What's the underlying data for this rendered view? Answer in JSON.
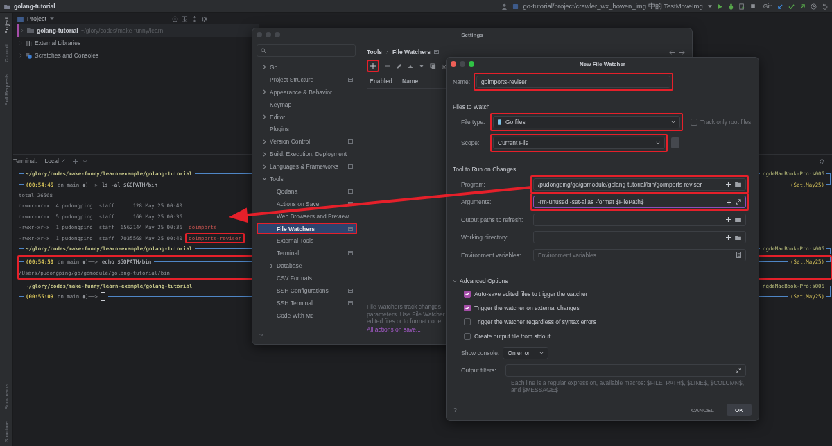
{
  "ide": {
    "project_name": "golang-tutorial",
    "run_config": "go-tutorial/project/crawler_wx_bowen_img 中的 TestMoveImg",
    "vcs_label": "Git:"
  },
  "tool_strip": {
    "top": [
      {
        "label": "Project",
        "selected": true
      },
      {
        "label": "Commit",
        "selected": false
      },
      {
        "label": "Pull Requests",
        "selected": false
      }
    ],
    "bottom": [
      {
        "label": "Bookmarks",
        "selected": false
      },
      {
        "label": "Structure",
        "selected": false
      }
    ]
  },
  "project_panel": {
    "title": "Project",
    "tree": [
      {
        "kind": "folder",
        "label": "golang-tutorial",
        "path": "~/glory/codes/make-funny/learn-",
        "selected": true
      },
      {
        "kind": "library",
        "label": "External Libraries",
        "selected": false
      },
      {
        "kind": "scratch",
        "label": "Scratches and Consoles",
        "selected": false
      }
    ]
  },
  "terminal": {
    "title": "Terminal:",
    "tabs": [
      {
        "label": "Local",
        "selected": true
      }
    ],
    "blocks": [
      {
        "highlighted": false,
        "lines": [
          {
            "kind": "top",
            "path": "~/glory/codes/make-funny/learn-example/golang-tutorial",
            "host": "ngdeMacBook-Pro:s006"
          },
          {
            "kind": "prompt",
            "time": "(00:54:45",
            "branch": "on main ●)──>",
            "command": "ls -al $GOPATH/bin",
            "date": "(Sat,May25)"
          },
          {
            "kind": "output",
            "text": "total 26568"
          },
          {
            "kind": "output",
            "text": "drwxr-xr-x  4 pudongping  staff      128 May 25 00:40 ."
          },
          {
            "kind": "output",
            "text": "drwxr-xr-x  5 pudongping  staff      160 May 25 00:36 .."
          },
          {
            "kind": "output",
            "text": "-rwxr-xr-x  1 pudongping  staff  6562144 May 25 00:36 ",
            "file": "goimports",
            "file_highlighted": false
          },
          {
            "kind": "output",
            "text": "-rwxr-xr-x  1 pudongping  staff  7035568 May 25 00:40 ",
            "file": "goimports-reviser",
            "file_highlighted": true
          },
          {
            "kind": "top",
            "path": "~/glory/codes/make-funny/learn-example/golang-tutorial",
            "host": "ngdeMacBook-Pro:s006"
          }
        ]
      },
      {
        "highlighted": true,
        "lines": [
          {
            "kind": "prompt",
            "time": "(00:54:50",
            "branch": "on main ●)──>",
            "command": "echo $GOPATH/bin",
            "date": "(Sat,May25)"
          },
          {
            "kind": "output",
            "text": "/Users/pudongping/go/gomodule/golang-tutorial/bin"
          }
        ]
      },
      {
        "highlighted": false,
        "lines": [
          {
            "kind": "top",
            "path": "~/glory/codes/make-funny/learn-example/golang-tutorial",
            "host": "ngdeMacBook-Pro:s006"
          },
          {
            "kind": "prompt",
            "time": "(00:55:09",
            "branch": "on main ●)──>",
            "cursor": true,
            "date": "(Sat,May25)"
          }
        ]
      }
    ]
  },
  "settings": {
    "title": "Settings",
    "nav": [
      {
        "label": "Go",
        "expandable": true,
        "expanded": false,
        "scoped": false,
        "selected": false
      },
      {
        "label": "Project Structure",
        "expandable": false,
        "scoped": true,
        "selected": false
      },
      {
        "label": "Appearance & Behavior",
        "expandable": true,
        "expanded": false,
        "scoped": false,
        "selected": false
      },
      {
        "label": "Keymap",
        "expandable": false,
        "scoped": false,
        "selected": false
      },
      {
        "label": "Editor",
        "expandable": true,
        "expanded": false,
        "scoped": false,
        "selected": false
      },
      {
        "label": "Plugins",
        "expandable": false,
        "scoped": false,
        "selected": false
      },
      {
        "label": "Version Control",
        "expandable": true,
        "expanded": false,
        "scoped": true,
        "selected": false
      },
      {
        "label": "Build, Execution, Deployment",
        "expandable": true,
        "expanded": false,
        "scoped": false,
        "selected": false
      },
      {
        "label": "Languages & Frameworks",
        "expandable": true,
        "expanded": false,
        "scoped": true,
        "selected": false
      },
      {
        "label": "Tools",
        "expandable": true,
        "expanded": true,
        "scoped": false,
        "selected": false,
        "children": [
          {
            "label": "Qodana",
            "expandable": false,
            "scoped": true,
            "selected": false
          },
          {
            "label": "Actions on Save",
            "expandable": false,
            "scoped": true,
            "selected": false
          },
          {
            "label": "Web Browsers and Preview",
            "expandable": false,
            "scoped": false,
            "selected": false
          },
          {
            "label": "File Watchers",
            "expandable": false,
            "scoped": true,
            "selected": true,
            "highlighted": true
          },
          {
            "label": "External Tools",
            "expandable": false,
            "scoped": false,
            "selected": false
          },
          {
            "label": "Terminal",
            "expandable": false,
            "scoped": true,
            "selected": false
          },
          {
            "label": "Database",
            "expandable": true,
            "expanded": false,
            "scoped": false,
            "selected": false
          },
          {
            "label": "CSV Formats",
            "expandable": false,
            "scoped": false,
            "selected": false
          },
          {
            "label": "SSH Configurations",
            "expandable": false,
            "scoped": true,
            "selected": false
          },
          {
            "label": "SSH Terminal",
            "expandable": false,
            "scoped": true,
            "selected": false
          },
          {
            "label": "Code With Me",
            "expandable": false,
            "scoped": false,
            "selected": false
          }
        ]
      }
    ],
    "breadcrumb": [
      "Tools",
      "File Watchers"
    ],
    "add_highlighted": true,
    "columns": [
      "Enabled",
      "Name"
    ],
    "description": [
      "File Watchers track changes",
      "parameters. Use File Watcher",
      "edited files or to format code"
    ],
    "link": "All actions on save...",
    "help": "?"
  },
  "watcher": {
    "title": "New File Watcher",
    "name": {
      "label": "Name:",
      "value": "goimports-reviser",
      "highlighted": true
    },
    "files_section": "Files to Watch",
    "file_type": {
      "label": "File type:",
      "value": "Go files",
      "highlighted": true
    },
    "track_root": {
      "label": "Track only root files",
      "checked": false,
      "disabled": true
    },
    "scope": {
      "label": "Scope:",
      "value": "Current File",
      "highlighted": true
    },
    "tool_section": "Tool to Run on Changes",
    "tool_fields": [
      {
        "kind": "path",
        "label": "Program:",
        "value": "/pudongping/go/gomodule/golang-tutorial/bin/goimports-reviser",
        "highlighted": true,
        "focused": false
      },
      {
        "kind": "macro",
        "label": "Arguments:",
        "value": "-rm-unused -set-alias -format $FilePath$",
        "highlighted": true,
        "focused": true
      },
      {
        "kind": "path",
        "label": "Output paths to refresh:",
        "highlighted": false,
        "focused": false
      },
      {
        "kind": "path",
        "label": "Working directory:",
        "highlighted": false,
        "focused": false
      },
      {
        "kind": "env",
        "label": "Environment variables:",
        "placeholder": "Environment variables",
        "highlighted": false,
        "focused": false
      }
    ],
    "advanced": {
      "label": "Advanced Options",
      "expanded": true,
      "options": [
        {
          "label": "Auto-save edited files to trigger the watcher",
          "checked": true
        },
        {
          "label": "Trigger the watcher on external changes",
          "checked": true
        },
        {
          "label": "Trigger the watcher regardless of syntax errors",
          "checked": false
        },
        {
          "label": "Create output file from stdout",
          "checked": false
        }
      ]
    },
    "show_console": {
      "label": "Show console:",
      "value": "On error"
    },
    "output_filters": {
      "label": "Output filters:",
      "hint": "Each line is a regular expression, available macros: $FILE_PATH$, $LINE$, $COLUMN$, and $MESSAGE$"
    },
    "buttons": [
      {
        "label": "CANCEL",
        "default": false
      },
      {
        "label": "OK",
        "default": true
      }
    ],
    "help": "?"
  }
}
